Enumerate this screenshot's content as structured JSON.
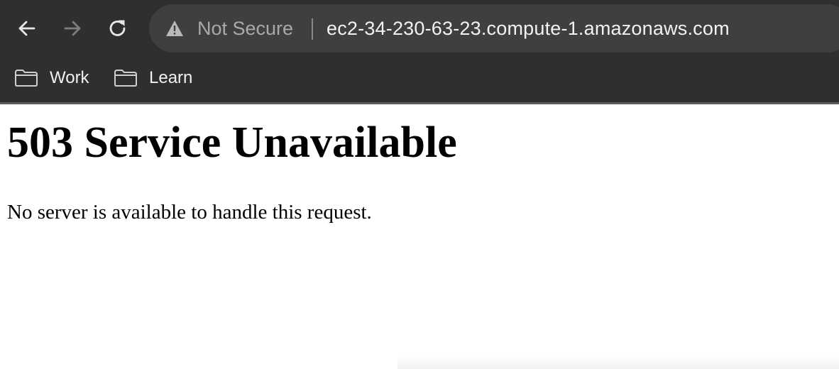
{
  "browser": {
    "security_label": "Not Secure",
    "url": "ec2-34-230-63-23.compute-1.amazonaws.com",
    "icons": {
      "back": "arrow-left-icon",
      "forward": "arrow-right-icon",
      "reload": "reload-icon",
      "security": "warning-triangle-icon",
      "bookmark": "folder-icon"
    },
    "forward_enabled": false
  },
  "bookmarks": [
    {
      "label": "Work"
    },
    {
      "label": "Learn"
    }
  ],
  "page": {
    "heading": "503 Service Unavailable",
    "message": "No server is available to handle this request."
  },
  "colors": {
    "chrome_background": "#2f2f2f",
    "omnibox_background": "#3f3f3f",
    "page_background": "#ffffff",
    "text": "#000000"
  }
}
